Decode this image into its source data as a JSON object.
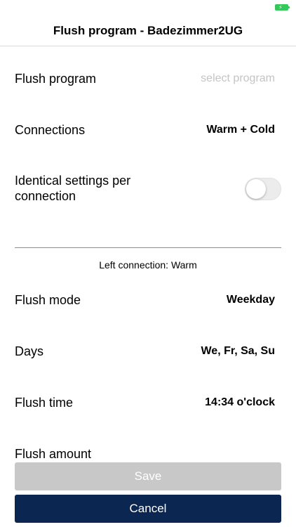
{
  "header": {
    "title": "Flush program - Badezimmer2UG"
  },
  "status": {
    "battery_icon": "battery-charging-icon",
    "battery_color": "#34c759"
  },
  "rows": {
    "flush_program": {
      "label": "Flush program",
      "value": "select program"
    },
    "connections": {
      "label": "Connections",
      "value": "Warm + Cold"
    },
    "identical_settings": {
      "label_line1": "Identical settings per",
      "label_line2": "connection",
      "toggle_on": false
    }
  },
  "section": {
    "caption": "Left connection: Warm"
  },
  "details": {
    "flush_mode": {
      "label": "Flush mode",
      "value": "Weekday"
    },
    "days": {
      "label": "Days",
      "value": "We, Fr, Sa, Su"
    },
    "flush_time": {
      "label": "Flush time",
      "value": "14:34 o'clock"
    },
    "flush_amount": {
      "label": "Flush amount"
    }
  },
  "buttons": {
    "save_label": "Save",
    "cancel_label": "Cancel",
    "save_color": "#c8c8c8",
    "cancel_color": "#0b2650"
  }
}
